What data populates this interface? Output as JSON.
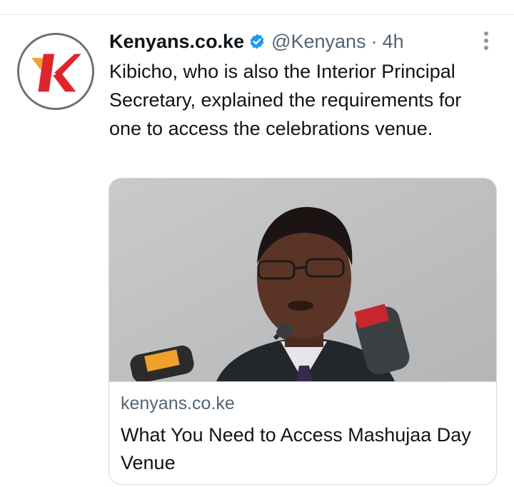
{
  "tweet": {
    "display_name": "Kenyans.co.ke",
    "handle": "@Kenyans",
    "separator": "·",
    "time": "4h",
    "text": "Kibicho, who is also the Interior Principal Secretary, explained the requirements for one to access the celebrations venue.",
    "avatar_icon": "kenyans-k-logo",
    "verified_icon": "verified-badge-icon",
    "more_icon": "more-options-icon"
  },
  "card": {
    "domain": "kenyans.co.ke",
    "title": "What You Need to Access Mashujaa Day Venue",
    "image": "photo of man in glasses speaking at microphones"
  },
  "colors": {
    "verified_blue": "#1d9bf0",
    "logo_red": "#e0242b",
    "logo_orange": "#f2a23a",
    "secondary_text": "#536471",
    "border": "#cfd9de"
  }
}
